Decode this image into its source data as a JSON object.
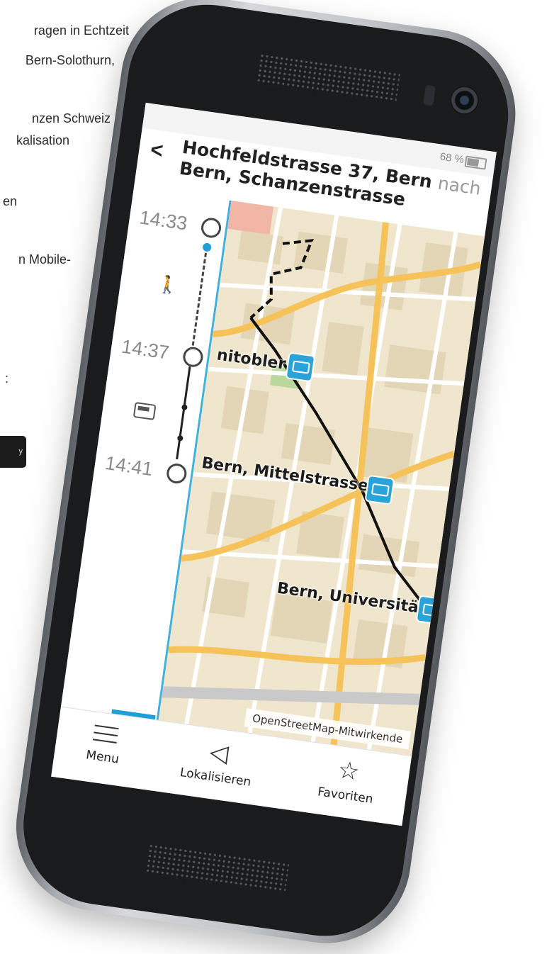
{
  "background_text": {
    "lines": [
      "ragen in Echtzeit",
      "Bern-Solothurn,",
      "nzen Schweiz",
      "kalisation",
      "en",
      "n Mobile-",
      ":"
    ],
    "store_badge_fragment": "y"
  },
  "status_bar": {
    "battery": "68 %"
  },
  "header": {
    "back_icon": "chevron-left-icon",
    "back_glyph": "<",
    "title_bold": "Hochfeldstrasse 37, Bern",
    "title_connector": "nach",
    "title_destination": "Bern, Schanzenstrasse"
  },
  "timeline": {
    "times": [
      "14:33",
      "14:37",
      "14:41"
    ],
    "walk_icon": "person-walking-icon",
    "walk_glyph": "🚶",
    "tram_icon": "tram-icon"
  },
  "map": {
    "stops": [
      "nitobler",
      "Bern, Mittelstrasse",
      "Bern, Universität"
    ],
    "attribution": "OpenStreetMap-Mitwirkende",
    "map_button_icon": "map-pin-icon",
    "map_button_glyph": "🗺",
    "route_color": "#111111",
    "accent_color": "#1e9fd6"
  },
  "bottom_nav": {
    "menu": "Menu",
    "locate": "Lokalisieren",
    "locate_glyph": "◁",
    "favorites": "Favoriten",
    "favorites_glyph": "☆"
  }
}
